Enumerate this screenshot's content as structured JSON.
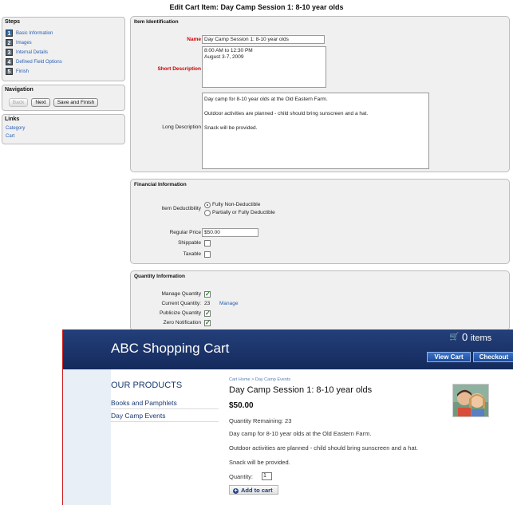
{
  "page_title": "Edit Cart Item: Day Camp Session 1: 8-10 year olds",
  "steps": {
    "title": "Steps",
    "items": [
      {
        "num": "1",
        "label": "Basic Information"
      },
      {
        "num": "2",
        "label": "Images"
      },
      {
        "num": "3",
        "label": "Internal Details"
      },
      {
        "num": "4",
        "label": "Defined Field Options"
      },
      {
        "num": "5",
        "label": "Finish"
      }
    ]
  },
  "navigation": {
    "title": "Navigation",
    "back": "Back",
    "next": "Next",
    "save_finish": "Save and Finish"
  },
  "links": {
    "title": "Links",
    "items": [
      "Category",
      "Cart"
    ]
  },
  "item_id": {
    "title": "Item Identification",
    "name_label": "Name",
    "name_value": "Day Camp Session 1: 8-10 year olds",
    "short_label": "Short Description",
    "short_lines": [
      "8:00 AM to 12:30 PM",
      "August 3-7, 2009"
    ],
    "long_label": "Long Description",
    "long_lines": [
      "Day camp for 8-10 year olds at the Old Eastern Farm.",
      "Outdoor activities are planned - child should bring sunscreen and a hat.",
      "Snack will be provided."
    ]
  },
  "financial": {
    "title": "Financial Information",
    "deduct_label": "Item Deductibility",
    "opt1": "Fully Non-Deductible",
    "opt2": "Partially or Fully Deductible",
    "price_label": "Regular Price",
    "price_value": "$50.00",
    "shippable_label": "Shippable",
    "taxable_label": "Taxable"
  },
  "quantity": {
    "title": "Quantity Information",
    "manage_label": "Manage Quantity",
    "current_label": "Current Quantity:",
    "current_value": "23",
    "manage_link": "Manage",
    "publicize_label": "Publicize Quantity",
    "zero_label": "Zero Notification"
  },
  "store": {
    "title": "ABC Shopping Cart",
    "cart_count": "0",
    "cart_items_word": "items",
    "view_cart": "View Cart",
    "checkout": "Checkout",
    "nav_title": "OUR PRODUCTS",
    "nav_items": [
      "Books and Pamphlets",
      "Day Camp Events"
    ],
    "breadcrumb": "Cart Home > Day Camp Events",
    "product_title": "Day Camp Session 1: 8-10 year olds",
    "price": "$50.00",
    "qty_remaining": "Quantity Remaining: 23",
    "desc": [
      "Day camp for 8-10 year olds at the Old Eastern Farm.",
      "Outdoor activities are planned - child should bring sunscreen and a hat.",
      "Snack will be provided."
    ],
    "qty_label": "Quantity:",
    "qty_value": "1",
    "add_to_cart": "Add to cart"
  }
}
